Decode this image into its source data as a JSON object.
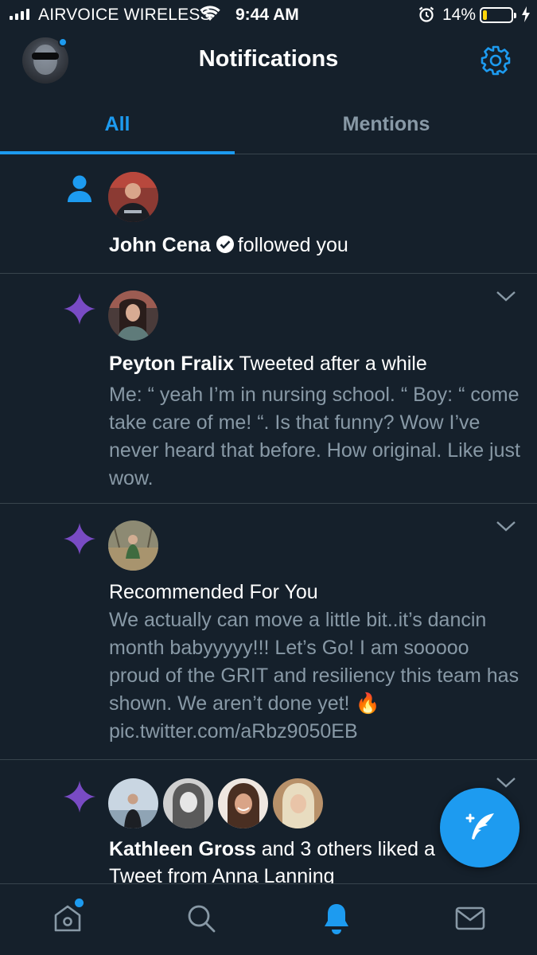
{
  "status_bar": {
    "carrier": "AIRVOICE WIRELESS",
    "time": "9:44 AM",
    "battery": "14%",
    "battery_level": 0.14,
    "battery_color": "#ffd60a"
  },
  "header": {
    "title": "Notifications",
    "avatar_icon": "profile-avatar",
    "settings_icon": "gear-icon"
  },
  "tabs": [
    {
      "label": "All",
      "active": true
    },
    {
      "label": "Mentions",
      "active": false
    }
  ],
  "notifications": [
    {
      "kind": "follow",
      "kind_icon": "person-icon",
      "actor": "John Cena",
      "verified": true,
      "action": "followed you"
    },
    {
      "kind": "tweet",
      "kind_icon": "sparkle-icon",
      "actor": "Peyton Fralix",
      "action": "Tweeted after a while",
      "body": "Me: “ yeah I’m in nursing school.  “ Boy: “ come take care of me! “. Is that funny? Wow I’ve never heard that before. How original. Like just wow."
    },
    {
      "kind": "recommended",
      "kind_icon": "sparkle-icon",
      "headline": "Recommended For You",
      "body": "We actually can move a little bit..it’s dancin month babyyyyy!!! Let’s Go! I am sooooo proud of the GRIT and resiliency this team has shown. We aren’t done yet!",
      "emoji": "🔥",
      "link": "pic.twitter.com/aRbz9050EB"
    },
    {
      "kind": "likes",
      "kind_icon": "sparkle-icon",
      "actor": "Kathleen Gross",
      "action": "and 3 others liked a",
      "line2": "Tweet from Anna Lanning"
    }
  ],
  "fab": {
    "icon": "compose-tweet-icon"
  },
  "bottom_nav": [
    {
      "name": "home",
      "icon": "home-icon",
      "badge": true
    },
    {
      "name": "search",
      "icon": "search-icon"
    },
    {
      "name": "notifications",
      "icon": "bell-icon",
      "active": true
    },
    {
      "name": "messages",
      "icon": "mail-icon"
    }
  ],
  "colors": {
    "background": "#15202b",
    "accent": "#1d9bf0",
    "secondary_text": "#8899a6",
    "divider": "#38444d",
    "sparkle": "#794bc4"
  }
}
